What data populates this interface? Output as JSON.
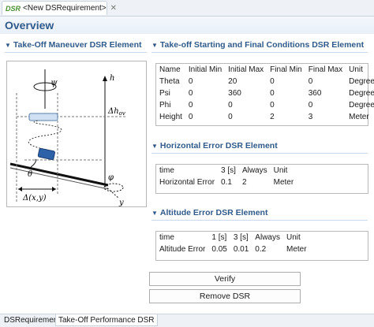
{
  "editor_tab": {
    "icon_text": "DSR",
    "title": "<New DSRequirement>"
  },
  "page_title": "Overview",
  "sections": {
    "takeoff_maneuver": "Take-Off Maneuver DSR Element",
    "start_final": "Take-off Starting and Final Conditions DSR Element",
    "horizontal": "Horizontal Error DSR Element",
    "altitude": "Altitude Error DSR Element"
  },
  "diagram_labels": {
    "psi": "ψ",
    "h": "h",
    "dh": "Δh",
    "dh_sub": "ov",
    "theta": "θ",
    "phi": "φ",
    "y": "y",
    "dxy": "Δ(x,y)"
  },
  "start_final_table": {
    "headers": [
      "Name",
      "Initial Min",
      "Initial Max",
      "Final Min",
      "Final Max",
      "Unit"
    ],
    "rows": [
      [
        "Theta",
        "0",
        "20",
        "0",
        "0",
        "Degree"
      ],
      [
        "Psi",
        "0",
        "360",
        "0",
        "360",
        "Degree"
      ],
      [
        "Phi",
        "0",
        "0",
        "0",
        "0",
        "Degree"
      ],
      [
        "Height",
        "0",
        "0",
        "2",
        "3",
        "Meter"
      ]
    ]
  },
  "horizontal_table": {
    "headers": [
      "time",
      "3 [s]",
      "Always",
      "Unit"
    ],
    "rows": [
      [
        "Horizontal Error",
        "0.1",
        "2",
        "Meter"
      ]
    ]
  },
  "altitude_table": {
    "headers": [
      "time",
      "1 [s]",
      "3 [s]",
      "Always",
      "Unit"
    ],
    "rows": [
      [
        "Altitude Error",
        "0.05",
        "0.01",
        "0.2",
        "Meter"
      ]
    ]
  },
  "buttons": {
    "verify": "Verify",
    "remove": "Remove DSR"
  },
  "bottom_tabs": [
    "DSRequirement",
    "Take-Off Performance DSR"
  ],
  "icons": {
    "twisty": "chevron-down-icon",
    "close": "close-icon"
  },
  "colors": {
    "section_title": "#2f5a8a",
    "header_bg": "#e8eff8",
    "app_icon": "#4b8f2f"
  }
}
